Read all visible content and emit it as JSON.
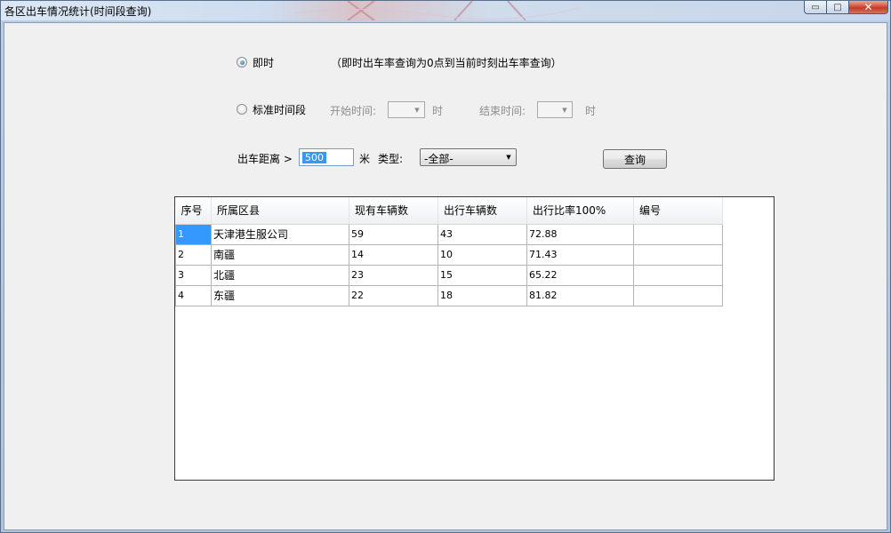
{
  "window": {
    "title": "各区出车情况统计(时间段查询)",
    "controls": {
      "minimize": "▭",
      "maximize": "□",
      "close": "✕"
    }
  },
  "query": {
    "instant_label": "即时",
    "instant_note": "（即时出车率查询为0点到当前时刻出车率查询）",
    "instant_checked": true,
    "period_label": "标准时间段",
    "period_checked": false,
    "start_time_label": "开始时间:",
    "end_time_label": "结束时间:",
    "hour_unit": "时",
    "distance_label": "出车距离 >",
    "distance_value": "500",
    "distance_unit": "米",
    "type_label": "类型:",
    "type_value": "-全部-",
    "query_button": "查询"
  },
  "table": {
    "columns": [
      "序号",
      "所属区县",
      "现有车辆数",
      "出行车辆数",
      "出行比率100%",
      "编号"
    ],
    "rows": [
      [
        "1",
        "天津港生服公司",
        "59",
        "43",
        "72.88",
        ""
      ],
      [
        "2",
        "南疆",
        "14",
        "10",
        "71.43",
        ""
      ],
      [
        "3",
        "北疆",
        "23",
        "15",
        "65.22",
        ""
      ],
      [
        "4",
        "东疆",
        "22",
        "18",
        "81.82",
        ""
      ]
    ]
  },
  "colors": {
    "selection": "#3399ff",
    "close_button": "#c43b23",
    "client_background": "#f0f0f0"
  }
}
